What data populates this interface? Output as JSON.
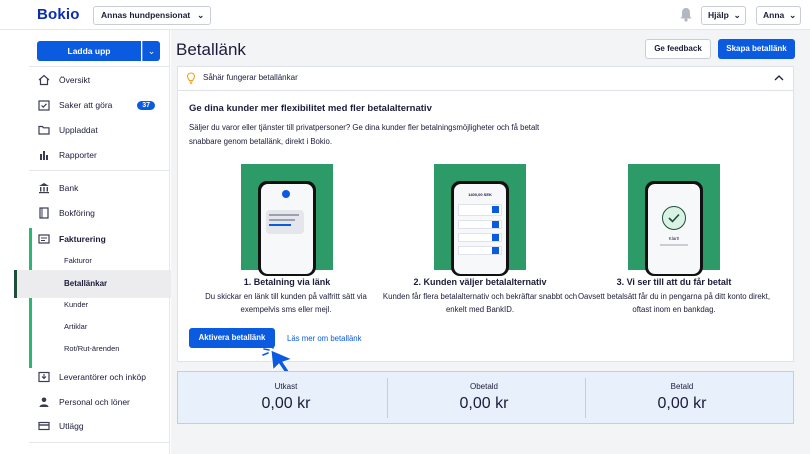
{
  "app": {
    "logo": "Bokio",
    "company": "Annas hundpensionat"
  },
  "topbar": {
    "help": "Hjälp",
    "user": "Anna",
    "chevron": "⌄"
  },
  "sidebar": {
    "upload_label": "Ladda upp",
    "items": [
      {
        "label": "Översikt",
        "icon": "home-icon"
      },
      {
        "label": "Saker att göra",
        "icon": "calendar-check-icon",
        "badge": "37"
      },
      {
        "label": "Uppladdat",
        "icon": "folder-icon"
      },
      {
        "label": "Rapporter",
        "icon": "bar-chart-icon"
      },
      {
        "label": "Bank",
        "icon": "bank-icon"
      },
      {
        "label": "Bokföring",
        "icon": "book-icon"
      },
      {
        "label": "Fakturering",
        "icon": "invoice-icon"
      },
      {
        "label": "Leverantörer och inköp",
        "icon": "inbox-icon"
      },
      {
        "label": "Personal och löner",
        "icon": "person-icon"
      },
      {
        "label": "Utlägg",
        "icon": "card-icon"
      }
    ],
    "sub_items": [
      "Fakturor",
      "Betallänkar",
      "Kunder",
      "Artiklar",
      "Rot/Rut-ärenden"
    ]
  },
  "page": {
    "title": "Betallänk",
    "feedback_label": "Ge feedback",
    "create_label": "Skapa betallänk"
  },
  "info": {
    "header": "Såhär fungerar betallänkar",
    "title": "Ge dina kunder mer flexibilitet med fler betalalternativ",
    "description": "Säljer du varor eller tjänster till privatpersoner? Ge dina kunder fler betalningsmöjligheter och få betalt snabbare genom betallänk, direkt i Bokio.",
    "steps": [
      {
        "title": "1. Betalning via länk",
        "text": "Du skickar en länk till kunden på valfritt sätt via exempelvis sms eller mejl."
      },
      {
        "title": "2. Kunden väljer betalalternativ",
        "text": "Kunden får flera betalalternativ och bekräftar snabbt och enkelt med BankID."
      },
      {
        "title": "3. Vi ser till att du får betalt",
        "text": "Oavsett betalsätt får du in pengarna på ditt konto direkt, oftast inom en bankdag."
      }
    ],
    "phone2_amount": "1400,00 SEK",
    "phone3_status": "Klart!",
    "activate_label": "Aktivera betallänk",
    "learn_more_label": "Läs mer om betallänk"
  },
  "stats": [
    {
      "label": "Utkast",
      "value": "0,00 kr"
    },
    {
      "label": "Obetald",
      "value": "0,00 kr"
    },
    {
      "label": "Betald",
      "value": "0,00 kr"
    }
  ],
  "colors": {
    "accent": "#0b5be0",
    "brand": "#0b2eaf",
    "green": "#2d9b67"
  }
}
